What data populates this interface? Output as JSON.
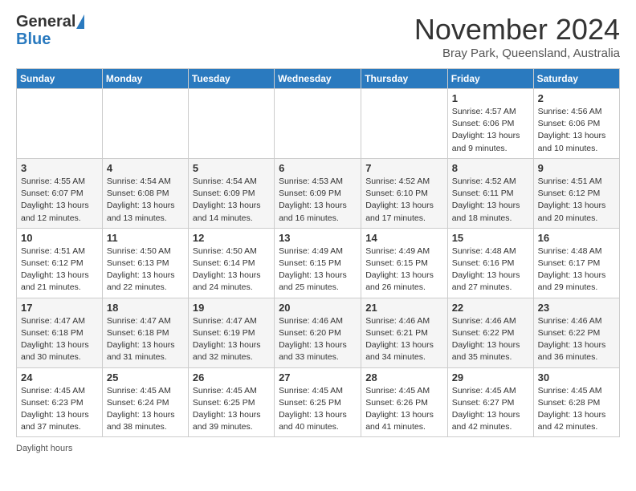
{
  "header": {
    "logo_general": "General",
    "logo_blue": "Blue",
    "title": "November 2024",
    "location": "Bray Park, Queensland, Australia"
  },
  "days_of_week": [
    "Sunday",
    "Monday",
    "Tuesday",
    "Wednesday",
    "Thursday",
    "Friday",
    "Saturday"
  ],
  "weeks": [
    [
      {
        "day": "",
        "info": ""
      },
      {
        "day": "",
        "info": ""
      },
      {
        "day": "",
        "info": ""
      },
      {
        "day": "",
        "info": ""
      },
      {
        "day": "",
        "info": ""
      },
      {
        "day": "1",
        "info": "Sunrise: 4:57 AM\nSunset: 6:06 PM\nDaylight: 13 hours\nand 9 minutes."
      },
      {
        "day": "2",
        "info": "Sunrise: 4:56 AM\nSunset: 6:06 PM\nDaylight: 13 hours\nand 10 minutes."
      }
    ],
    [
      {
        "day": "3",
        "info": "Sunrise: 4:55 AM\nSunset: 6:07 PM\nDaylight: 13 hours\nand 12 minutes."
      },
      {
        "day": "4",
        "info": "Sunrise: 4:54 AM\nSunset: 6:08 PM\nDaylight: 13 hours\nand 13 minutes."
      },
      {
        "day": "5",
        "info": "Sunrise: 4:54 AM\nSunset: 6:09 PM\nDaylight: 13 hours\nand 14 minutes."
      },
      {
        "day": "6",
        "info": "Sunrise: 4:53 AM\nSunset: 6:09 PM\nDaylight: 13 hours\nand 16 minutes."
      },
      {
        "day": "7",
        "info": "Sunrise: 4:52 AM\nSunset: 6:10 PM\nDaylight: 13 hours\nand 17 minutes."
      },
      {
        "day": "8",
        "info": "Sunrise: 4:52 AM\nSunset: 6:11 PM\nDaylight: 13 hours\nand 18 minutes."
      },
      {
        "day": "9",
        "info": "Sunrise: 4:51 AM\nSunset: 6:12 PM\nDaylight: 13 hours\nand 20 minutes."
      }
    ],
    [
      {
        "day": "10",
        "info": "Sunrise: 4:51 AM\nSunset: 6:12 PM\nDaylight: 13 hours\nand 21 minutes."
      },
      {
        "day": "11",
        "info": "Sunrise: 4:50 AM\nSunset: 6:13 PM\nDaylight: 13 hours\nand 22 minutes."
      },
      {
        "day": "12",
        "info": "Sunrise: 4:50 AM\nSunset: 6:14 PM\nDaylight: 13 hours\nand 24 minutes."
      },
      {
        "day": "13",
        "info": "Sunrise: 4:49 AM\nSunset: 6:15 PM\nDaylight: 13 hours\nand 25 minutes."
      },
      {
        "day": "14",
        "info": "Sunrise: 4:49 AM\nSunset: 6:15 PM\nDaylight: 13 hours\nand 26 minutes."
      },
      {
        "day": "15",
        "info": "Sunrise: 4:48 AM\nSunset: 6:16 PM\nDaylight: 13 hours\nand 27 minutes."
      },
      {
        "day": "16",
        "info": "Sunrise: 4:48 AM\nSunset: 6:17 PM\nDaylight: 13 hours\nand 29 minutes."
      }
    ],
    [
      {
        "day": "17",
        "info": "Sunrise: 4:47 AM\nSunset: 6:18 PM\nDaylight: 13 hours\nand 30 minutes."
      },
      {
        "day": "18",
        "info": "Sunrise: 4:47 AM\nSunset: 6:18 PM\nDaylight: 13 hours\nand 31 minutes."
      },
      {
        "day": "19",
        "info": "Sunrise: 4:47 AM\nSunset: 6:19 PM\nDaylight: 13 hours\nand 32 minutes."
      },
      {
        "day": "20",
        "info": "Sunrise: 4:46 AM\nSunset: 6:20 PM\nDaylight: 13 hours\nand 33 minutes."
      },
      {
        "day": "21",
        "info": "Sunrise: 4:46 AM\nSunset: 6:21 PM\nDaylight: 13 hours\nand 34 minutes."
      },
      {
        "day": "22",
        "info": "Sunrise: 4:46 AM\nSunset: 6:22 PM\nDaylight: 13 hours\nand 35 minutes."
      },
      {
        "day": "23",
        "info": "Sunrise: 4:46 AM\nSunset: 6:22 PM\nDaylight: 13 hours\nand 36 minutes."
      }
    ],
    [
      {
        "day": "24",
        "info": "Sunrise: 4:45 AM\nSunset: 6:23 PM\nDaylight: 13 hours\nand 37 minutes."
      },
      {
        "day": "25",
        "info": "Sunrise: 4:45 AM\nSunset: 6:24 PM\nDaylight: 13 hours\nand 38 minutes."
      },
      {
        "day": "26",
        "info": "Sunrise: 4:45 AM\nSunset: 6:25 PM\nDaylight: 13 hours\nand 39 minutes."
      },
      {
        "day": "27",
        "info": "Sunrise: 4:45 AM\nSunset: 6:25 PM\nDaylight: 13 hours\nand 40 minutes."
      },
      {
        "day": "28",
        "info": "Sunrise: 4:45 AM\nSunset: 6:26 PM\nDaylight: 13 hours\nand 41 minutes."
      },
      {
        "day": "29",
        "info": "Sunrise: 4:45 AM\nSunset: 6:27 PM\nDaylight: 13 hours\nand 42 minutes."
      },
      {
        "day": "30",
        "info": "Sunrise: 4:45 AM\nSunset: 6:28 PM\nDaylight: 13 hours\nand 42 minutes."
      }
    ]
  ],
  "footer": {
    "daylight_label": "Daylight hours"
  }
}
